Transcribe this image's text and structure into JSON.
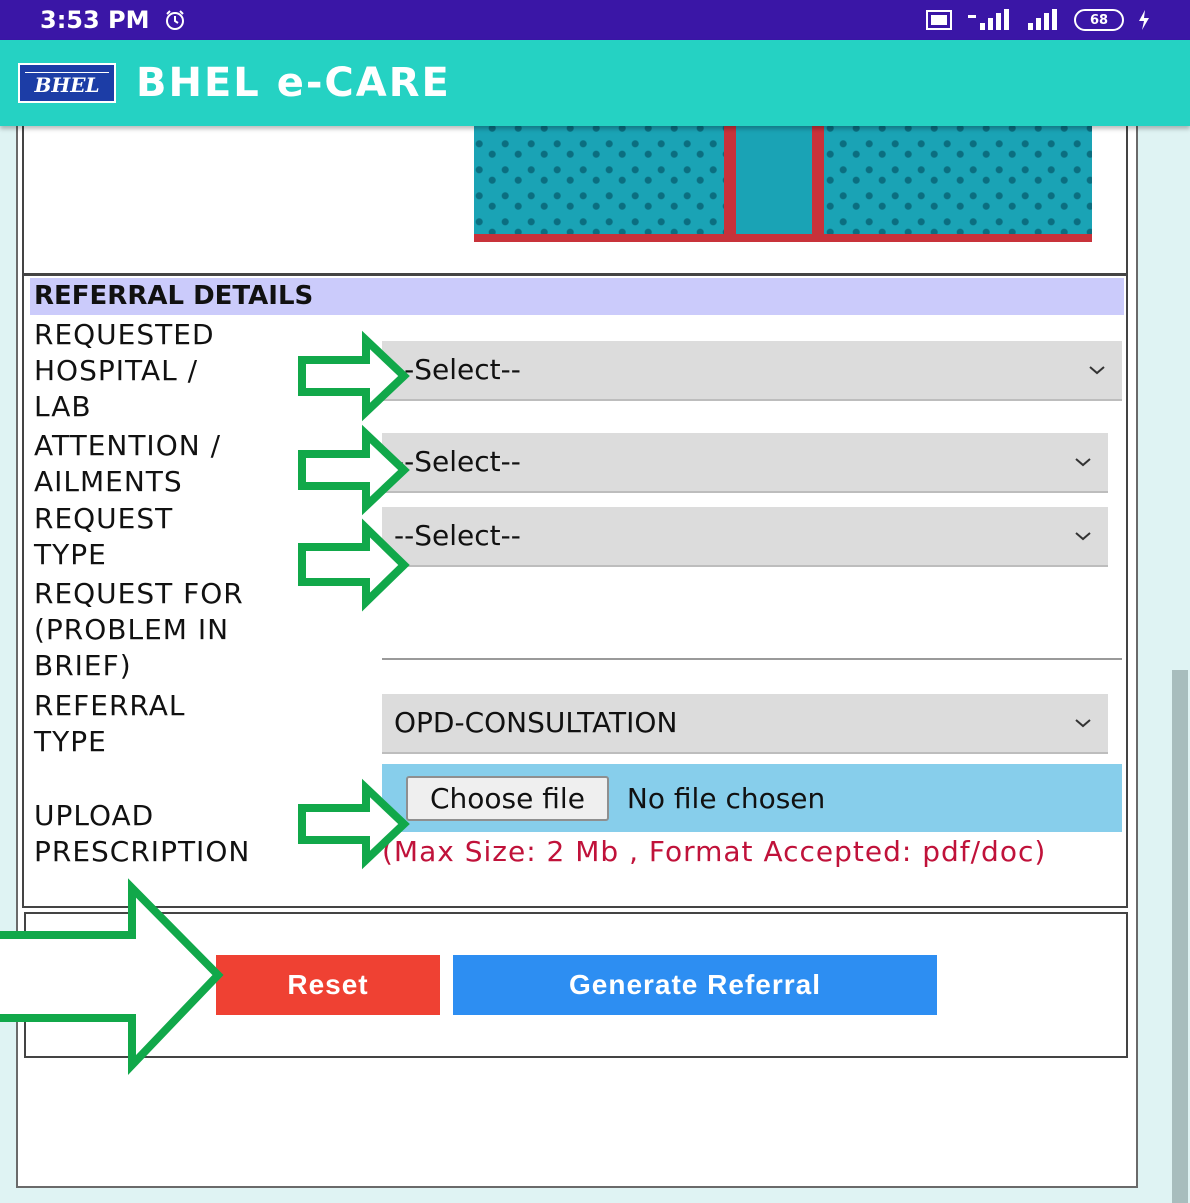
{
  "status_bar": {
    "time": "3:53 PM",
    "battery": "68"
  },
  "app_bar": {
    "logo_text": "BHEL",
    "title": "BHEL e-CARE"
  },
  "referral": {
    "section_title": "REFERRAL DETAILS",
    "fields": {
      "hospital_label": "REQUESTED\nHOSPITAL /\nLAB",
      "hospital_value": "--Select--",
      "ailment_label": "ATTENTION /\nAILMENTS",
      "ailment_value": "--Select--",
      "request_type_label": "REQUEST\nTYPE",
      "request_type_value": "--Select--",
      "request_for_label": "REQUEST FOR\n(PROBLEM IN\nBRIEF)",
      "request_for_value": "",
      "referral_type_label": "REFERRAL\nTYPE",
      "referral_type_value": "OPD-CONSULTATION",
      "upload_label": "UPLOAD\nPRESCRIPTION",
      "choose_file_label": "Choose file",
      "no_file_text": "No file chosen",
      "upload_hint": "(Max Size: 2 Mb , Format Accepted: pdf/doc)"
    }
  },
  "actions": {
    "reset_label": "Reset",
    "generate_label": "Generate Referral"
  },
  "colors": {
    "status_bar": "#3a16a6",
    "app_bar": "#25d2c3",
    "section_header": "#cbcbfb",
    "upload_bg": "#87ceeb",
    "hint_text": "#c0123a",
    "reset_button": "#ef4133",
    "generate_button": "#2d8ef2",
    "annotation_arrow": "#11a84a"
  }
}
